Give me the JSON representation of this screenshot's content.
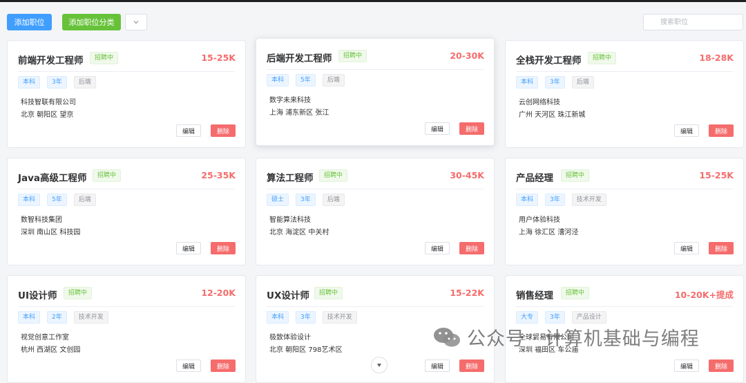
{
  "toolbar": {
    "add_label": "添加职位",
    "add_category_label": "添加职位分类",
    "search_placeholder": "搜索职位"
  },
  "actions": {
    "edit": "编辑",
    "delete": "删除"
  },
  "jobs": [
    {
      "title": "前端开发工程师",
      "status": "招聘中",
      "salary": "15-25K",
      "education": "本科",
      "experience": "3年",
      "category": "后端",
      "company": "科技智联有限公司",
      "location": "北京 朝阳区 望京"
    },
    {
      "title": "后端开发工程师",
      "status": "招聘中",
      "salary": "20-30K",
      "education": "本科",
      "experience": "5年",
      "category": "后端",
      "company": "数字未来科技",
      "location": "上海 浦东新区 张江"
    },
    {
      "title": "全栈开发工程师",
      "status": "招聘中",
      "salary": "18-28K",
      "education": "本科",
      "experience": "3年",
      "category": "后端",
      "company": "云创网络科技",
      "location": "广州 天河区 珠江新城"
    },
    {
      "title": "Java高级工程师",
      "status": "招聘中",
      "salary": "25-35K",
      "education": "本科",
      "experience": "5年",
      "category": "后端",
      "company": "数智科技集团",
      "location": "深圳 南山区 科技园"
    },
    {
      "title": "算法工程师",
      "status": "招聘中",
      "salary": "30-45K",
      "education": "硕士",
      "experience": "3年",
      "category": "后端",
      "company": "智能算法科技",
      "location": "北京 海淀区 中关村"
    },
    {
      "title": "产品经理",
      "status": "招聘中",
      "salary": "15-25K",
      "education": "本科",
      "experience": "3年",
      "category": "技术开发",
      "company": "用户体验科技",
      "location": "上海 徐汇区 漕河泾"
    },
    {
      "title": "UI设计师",
      "status": "招聘中",
      "salary": "12-20K",
      "education": "本科",
      "experience": "2年",
      "category": "技术开发",
      "company": "视觉创意工作室",
      "location": "杭州 西湖区 文创园"
    },
    {
      "title": "UX设计师",
      "status": "招聘中",
      "salary": "15-22K",
      "education": "本科",
      "experience": "3年",
      "category": "技术开发",
      "company": "极致体验设计",
      "location": "北京 朝阳区 798艺术区"
    },
    {
      "title": "销售经理",
      "status": "招聘中",
      "salary": "10-20K+提成",
      "education": "大专",
      "experience": "3年",
      "category": "产品设计",
      "company": "全球贸易有限公司",
      "location": "深圳 福田区 车公庙"
    }
  ],
  "watermark": "公众号 · 计算机基础与编程"
}
